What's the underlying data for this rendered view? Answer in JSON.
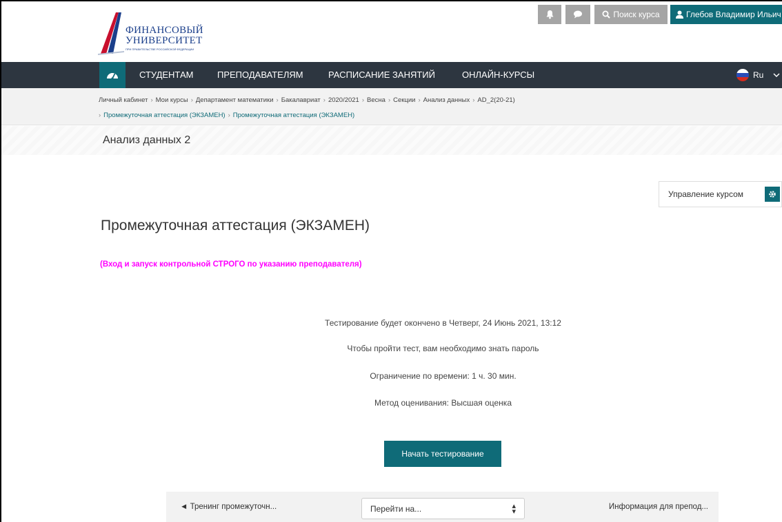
{
  "header": {
    "logo_line1": "ФИНАНСОВЫЙ",
    "logo_line2": "УНИВЕРСИТЕТ",
    "logo_sub": "ПРИ ПРАВИТЕЛЬСТВЕ РОССИЙСКОЙ ФЕДЕРАЦИИ",
    "search_label": "Поиск курса",
    "user_name": "Глебов Владимир Ильич"
  },
  "nav": {
    "items": [
      "СТУДЕНТАМ",
      "ПРЕПОДАВАТЕЛЯМ",
      "РАСПИСАНИЕ ЗАНЯТИЙ",
      "ОНЛАЙН-КУРСЫ"
    ],
    "lang": "Ru"
  },
  "breadcrumb": {
    "line1": [
      "Личный кабинет",
      "Мои курсы",
      "Департамент математики",
      "Бакалавриат",
      "2020/2021",
      "Весна",
      "Секции",
      "Анализ данных",
      "AD_2(20-21)"
    ],
    "line2": [
      "Промежуточная аттестация (ЭКЗАМЕН)",
      "Промежуточная аттестация (ЭКЗАМЕН)"
    ]
  },
  "course_title": "Анализ данных 2",
  "manage_label": "Управление курсом",
  "page_title": "Промежуточная аттестация (ЭКЗАМЕН)",
  "notice": "(Вход и запуск контрольной СТРОГО по указанию преподавателя)",
  "quiz_info": {
    "close_time": "Тестирование будет окончено в Четверг, 24 Июнь 2021, 13:12",
    "password": "Чтобы пройти тест, вам необходимо знать пароль",
    "time_limit": "Ограничение по времени: 1 ч. 30 мин.",
    "grading": "Метод оценивания: Высшая оценка"
  },
  "start_button": "Начать тестирование",
  "footer_nav": {
    "prev": "◄ Тренинг промежуточн...",
    "jump_label": "Перейти на...",
    "next": "Информация для препод..."
  },
  "colors": {
    "teal": "#0f6b78",
    "nav_bg": "#2d3640",
    "notice": "#ff00ff"
  }
}
